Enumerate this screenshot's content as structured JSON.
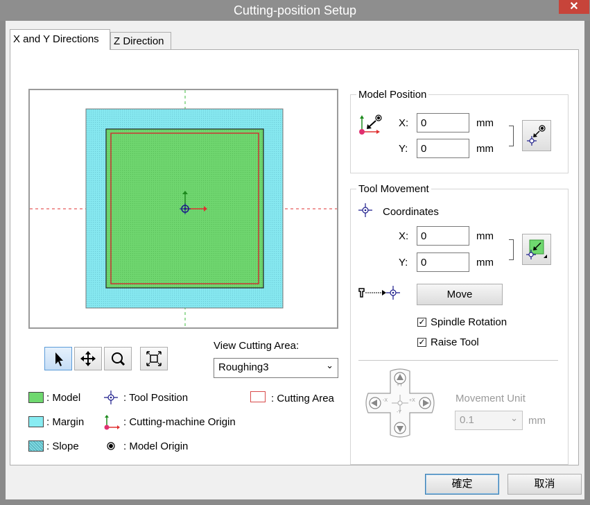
{
  "window": {
    "title": "Cutting-position Setup",
    "close_glyph": "✕"
  },
  "tabs": [
    {
      "label": "X and Y Directions",
      "active": true
    },
    {
      "label": "Z Direction",
      "active": false
    }
  ],
  "preview": {
    "colors": {
      "model": "#6fd86f",
      "margin": "#88ecf2",
      "cutting_area": "#d84a4a",
      "axis_x": "#e03030",
      "axis_y": "#2a9a2a"
    }
  },
  "toolbar": {
    "icons": [
      "select-arrow-icon",
      "pan-icon",
      "zoom-icon",
      "fit-view-icon"
    ]
  },
  "view_cutting_area": {
    "label": "View Cutting Area:",
    "selected": "Roughing3"
  },
  "legend": {
    "model": ": Model",
    "margin": ": Margin",
    "slope": ": Slope",
    "tool_position": ": Tool Position",
    "machine_origin": ": Cutting-machine Origin",
    "model_origin": ": Model Origin",
    "cutting_area": ": Cutting Area"
  },
  "model_position": {
    "title": "Model Position",
    "x_label": "X:",
    "y_label": "Y:",
    "x_value": "0",
    "y_value": "0",
    "unit": "mm"
  },
  "tool_movement": {
    "title": "Tool Movement",
    "coordinates_label": "Coordinates",
    "x_label": "X:",
    "y_label": "Y:",
    "x_value": "0",
    "y_value": "0",
    "unit": "mm",
    "move_label": "Move",
    "spindle_rotation_label": "Spindle Rotation",
    "spindle_rotation_checked": true,
    "raise_tool_label": "Raise Tool",
    "raise_tool_checked": true,
    "movement_unit_label": "Movement Unit",
    "movement_unit_value": "0.1",
    "movement_unit_suffix": "mm",
    "pad": {
      "up": "+Y",
      "down": "-Y",
      "left": "-X",
      "right": "+X"
    }
  },
  "footer": {
    "ok_label": "確定",
    "cancel_label": "取消"
  }
}
